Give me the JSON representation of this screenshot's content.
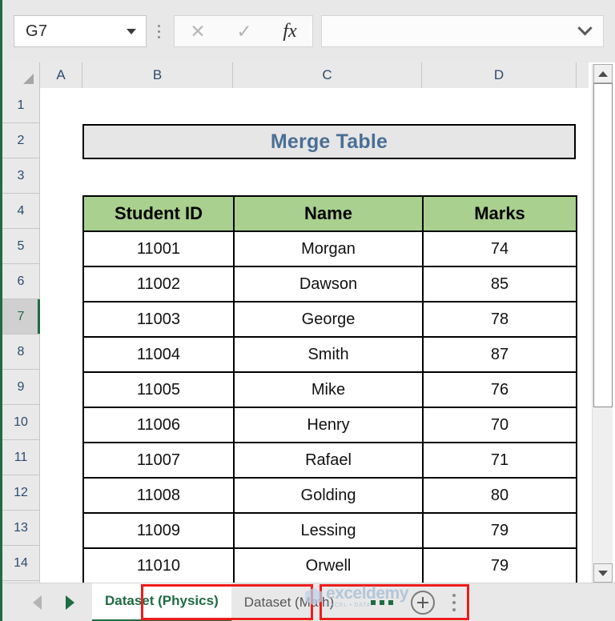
{
  "formula_bar": {
    "name_box_value": "G7",
    "name_box_placeholder": "Name Box",
    "cancel_icon": "close-x-icon",
    "enter_icon": "check-icon",
    "fx_label": "fx",
    "formula_value": "",
    "formula_placeholder": "",
    "expand_icon": "chevron-down-icon"
  },
  "grid": {
    "columns": [
      "A",
      "B",
      "C",
      "D"
    ],
    "rows": [
      "1",
      "2",
      "3",
      "4",
      "5",
      "6",
      "7",
      "8",
      "9",
      "10",
      "11",
      "12",
      "13",
      "14"
    ],
    "selected_row": "7",
    "selected_cell": "G7"
  },
  "table": {
    "title": "Merge Table",
    "headers": [
      "Student ID",
      "Name",
      "Marks"
    ],
    "rows": [
      [
        "11001",
        "Morgan",
        "74"
      ],
      [
        "11002",
        "Dawson",
        "85"
      ],
      [
        "11003",
        "George",
        "78"
      ],
      [
        "11004",
        "Smith",
        "87"
      ],
      [
        "11005",
        "Mike",
        "76"
      ],
      [
        "11006",
        "Henry",
        "70"
      ],
      [
        "11007",
        "Rafael",
        "71"
      ],
      [
        "11008",
        "Golding",
        "80"
      ],
      [
        "11009",
        "Lessing",
        "79"
      ],
      [
        "11010",
        "Orwell",
        "79"
      ]
    ],
    "header_fill": "#A9D08E",
    "title_fill": "#E6E6E6",
    "title_color": "#4A6F96"
  },
  "tabs": {
    "prev_icon": "nav-left-arrow-icon",
    "next_icon": "nav-right-arrow-icon",
    "items": [
      {
        "label": "Dataset (Physics)",
        "active": true
      },
      {
        "label": "Dataset (Math)",
        "active": false
      }
    ],
    "overflow_label": "...",
    "add_sheet_icon": "plus-circle-icon",
    "more_icon": "vertical-dots-icon",
    "highlight_color": "#EE1C1C",
    "active_tab_color": "#217346"
  },
  "watermark": {
    "main": "exceldemy",
    "sub": "EXCEL • DATA"
  }
}
